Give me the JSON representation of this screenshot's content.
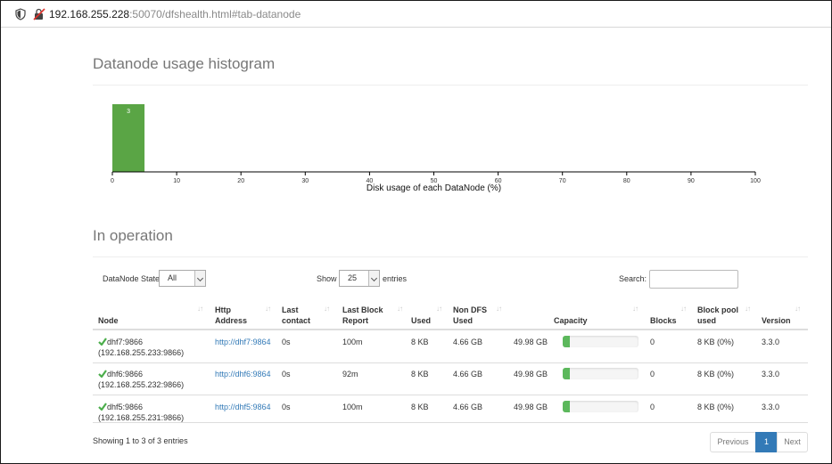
{
  "browser": {
    "url_host": "192.168.255.228",
    "url_rest": ":50070/dfshealth.html#tab-datanode"
  },
  "histogram": {
    "title": "Datanode usage histogram"
  },
  "chart_data": {
    "type": "bar",
    "title": "",
    "xlabel": "Disk usage of each DataNode (%)",
    "ylabel": "",
    "xlim": [
      0,
      100
    ],
    "x_ticks": [
      "0",
      "10",
      "20",
      "30",
      "40",
      "50",
      "60",
      "70",
      "80",
      "90",
      "100"
    ],
    "bins": [
      {
        "from": 0,
        "to": 5,
        "value": 3,
        "label": "3"
      }
    ],
    "bar_color": "#5aa545"
  },
  "operation": {
    "title": "In operation",
    "state_label": "DataNode State",
    "state_value": "All",
    "show_label": "Show",
    "show_value": "25",
    "entries_label": "entries",
    "search_label": "Search:"
  },
  "table": {
    "columns": [
      {
        "l1": "Node",
        "l2": ""
      },
      {
        "l1": "Http",
        "l2": "Address"
      },
      {
        "l1": "Last",
        "l2": "contact"
      },
      {
        "l1": "Last Block",
        "l2": "Report"
      },
      {
        "l1": "Used",
        "l2": ""
      },
      {
        "l1": "Non DFS",
        "l2": "Used"
      },
      {
        "l1": "Capacity",
        "l2": ""
      },
      {
        "l1": "Blocks",
        "l2": ""
      },
      {
        "l1": "Block pool",
        "l2": "used"
      },
      {
        "l1": "Version",
        "l2": ""
      }
    ],
    "rows": [
      {
        "node": "dhf7:9866",
        "ip": "(192.168.255.233:9866)",
        "http": "http://dhf7:9864",
        "last_contact": "0s",
        "last_block_report": "100m",
        "used": "8 KB",
        "non_dfs_used": "4.66 GB",
        "capacity": "49.98 GB",
        "capacity_usage": 0.093,
        "blocks": "0",
        "block_pool_used": "8 KB (0%)",
        "version": "3.3.0"
      },
      {
        "node": "dhf6:9866",
        "ip": "(192.168.255.232:9866)",
        "http": "http://dhf6:9864",
        "last_contact": "0s",
        "last_block_report": "92m",
        "used": "8 KB",
        "non_dfs_used": "4.66 GB",
        "capacity": "49.98 GB",
        "capacity_usage": 0.093,
        "blocks": "0",
        "block_pool_used": "8 KB (0%)",
        "version": "3.3.0"
      },
      {
        "node": "dhf5:9866",
        "ip": "(192.168.255.231:9866)",
        "http": "http://dhf5:9864",
        "last_contact": "0s",
        "last_block_report": "100m",
        "used": "8 KB",
        "non_dfs_used": "4.66 GB",
        "capacity": "49.98 GB",
        "capacity_usage": 0.093,
        "blocks": "0",
        "block_pool_used": "8 KB (0%)",
        "version": "3.3.0"
      }
    ]
  },
  "footer": {
    "info": "Showing 1 to 3 of 3 entries",
    "prev": "Previous",
    "page": "1",
    "next": "Next"
  },
  "colors": {
    "accent": "#337ab7",
    "bar": "#5aa545",
    "progress": "#5cb85c",
    "check": "#4cae4c"
  },
  "icons": [
    "shield-icon",
    "insecure-lock-icon",
    "check-icon",
    "sort-icon",
    "chevron-down-icon"
  ]
}
